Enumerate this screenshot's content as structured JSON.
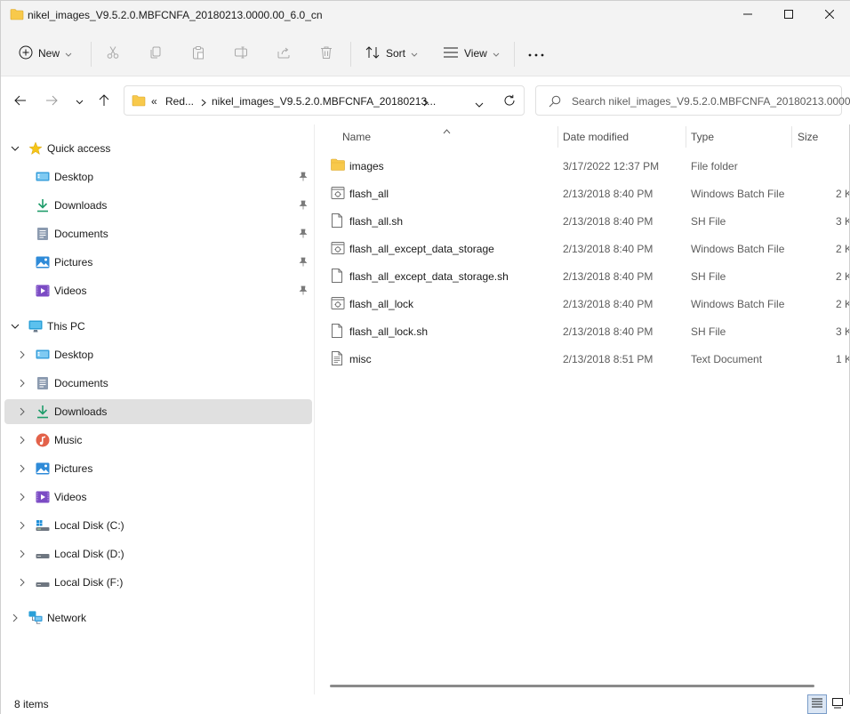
{
  "window": {
    "title": "nikel_images_V9.5.2.0.MBFCNFA_20180213.0000.00_6.0_cn",
    "minimize_icon": "minimize-icon",
    "maximize_icon": "maximize-icon",
    "close_icon": "close-icon"
  },
  "toolbar": {
    "new_label": "New",
    "sort_label": "Sort",
    "view_label": "View",
    "icons": [
      "plus-icon",
      "cut-icon",
      "copy-icon",
      "paste-icon",
      "rename-icon",
      "share-icon",
      "delete-icon",
      "sort-icon",
      "view-icon",
      "more-icon"
    ]
  },
  "address": {
    "overflow": "«",
    "crumb1": "Red...",
    "crumb2": "nikel_images_V9.5.2.0.MBFCNFA_20180213...",
    "search_placeholder": "Search nikel_images_V9.5.2.0.MBFCNFA_20180213.0000...."
  },
  "sidebar": {
    "quick_access": "Quick access",
    "quick_items": [
      {
        "label": "Desktop",
        "icon": "desktop-icon"
      },
      {
        "label": "Downloads",
        "icon": "download-icon"
      },
      {
        "label": "Documents",
        "icon": "documents-icon"
      },
      {
        "label": "Pictures",
        "icon": "pictures-icon"
      },
      {
        "label": "Videos",
        "icon": "videos-icon"
      }
    ],
    "this_pc": "This PC",
    "pc_items": [
      {
        "label": "Desktop",
        "icon": "desktop-icon"
      },
      {
        "label": "Documents",
        "icon": "documents-icon"
      },
      {
        "label": "Downloads",
        "icon": "download-icon",
        "selected": true
      },
      {
        "label": "Music",
        "icon": "music-icon"
      },
      {
        "label": "Pictures",
        "icon": "pictures-icon"
      },
      {
        "label": "Videos",
        "icon": "videos-icon"
      },
      {
        "label": "Local Disk (C:)",
        "icon": "windows-drive-icon"
      },
      {
        "label": "Local Disk (D:)",
        "icon": "drive-icon"
      },
      {
        "label": "Local Disk (F:)",
        "icon": "drive-icon"
      }
    ],
    "network": "Network"
  },
  "columns": {
    "name": "Name",
    "date": "Date modified",
    "type": "Type",
    "size": "Size"
  },
  "files": [
    {
      "name": "images",
      "date": "3/17/2022 12:37 PM",
      "type": "File folder",
      "size": "",
      "icon": "folder-icon"
    },
    {
      "name": "flash_all",
      "date": "2/13/2018 8:40 PM",
      "type": "Windows Batch File",
      "size": "2 K",
      "icon": "batch-file-icon"
    },
    {
      "name": "flash_all.sh",
      "date": "2/13/2018 8:40 PM",
      "type": "SH File",
      "size": "3 K",
      "icon": "file-icon"
    },
    {
      "name": "flash_all_except_data_storage",
      "date": "2/13/2018 8:40 PM",
      "type": "Windows Batch File",
      "size": "2 K",
      "icon": "batch-file-icon"
    },
    {
      "name": "flash_all_except_data_storage.sh",
      "date": "2/13/2018 8:40 PM",
      "type": "SH File",
      "size": "2 K",
      "icon": "file-icon"
    },
    {
      "name": "flash_all_lock",
      "date": "2/13/2018 8:40 PM",
      "type": "Windows Batch File",
      "size": "2 K",
      "icon": "batch-file-icon"
    },
    {
      "name": "flash_all_lock.sh",
      "date": "2/13/2018 8:40 PM",
      "type": "SH File",
      "size": "3 K",
      "icon": "file-icon"
    },
    {
      "name": "misc",
      "date": "2/13/2018 8:51 PM",
      "type": "Text Document",
      "size": "1 K",
      "icon": "text-file-icon"
    }
  ],
  "status": {
    "count": "8 items"
  },
  "colors": {
    "accent": "#0067c0",
    "folder": "#f8c94b",
    "selected_bg": "#e0e0e0",
    "chrome_bg": "#f3f3f3"
  }
}
